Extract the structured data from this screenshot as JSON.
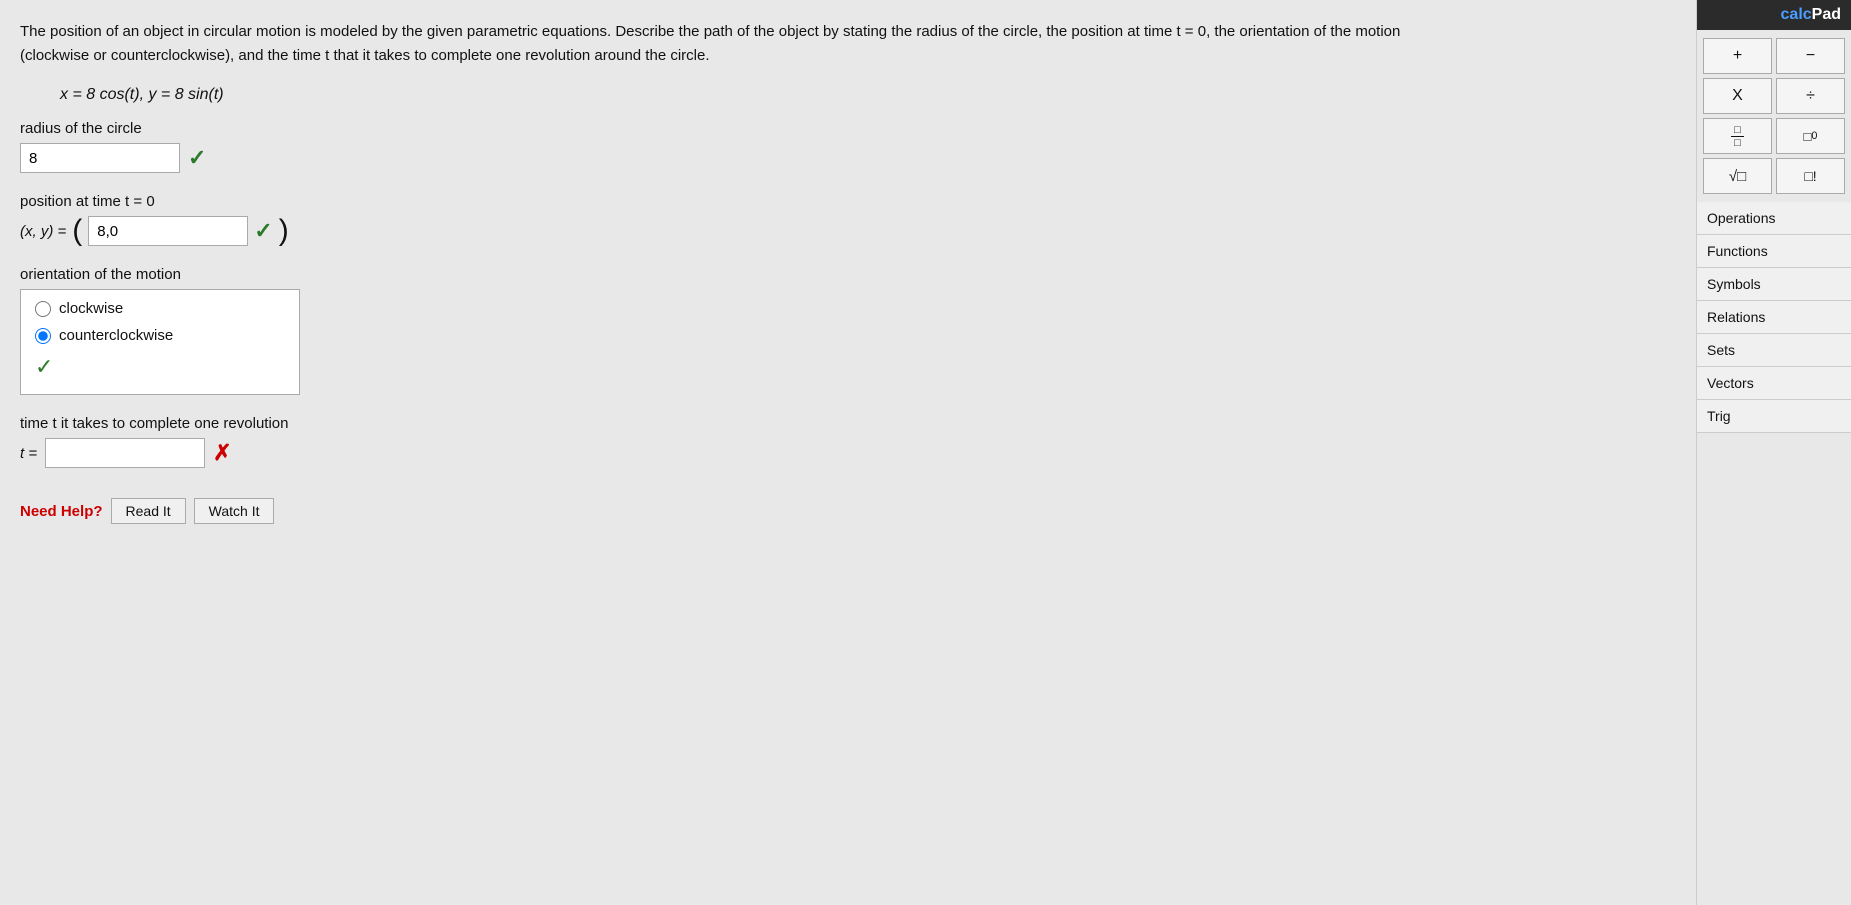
{
  "question": {
    "text": "The position of an object in circular motion is modeled by the given parametric equations. Describe the path of the object by stating the radius of the circle, the position at time t = 0, the orientation of the motion (clockwise or counterclockwise), and the time t that it takes to complete one revolution around the circle.",
    "equation": "x = 8 cos(t),  y = 8 sin(t)"
  },
  "radius": {
    "label": "radius of the circle",
    "value": "8"
  },
  "position": {
    "label": "position at time  t = 0",
    "prefix": "(x, y) =",
    "value": "8,0"
  },
  "orientation": {
    "label": "orientation of the motion",
    "options": [
      "clockwise",
      "counterclockwise"
    ],
    "selected": "counterclockwise"
  },
  "time": {
    "label": "time t it takes to complete one revolution",
    "prefix": "t =",
    "value": ""
  },
  "needHelp": {
    "text": "Need Help?",
    "buttons": [
      "Read It",
      "Watch It"
    ]
  },
  "calcpad": {
    "title_blue": "calc",
    "title_white": "Pad",
    "buttons": [
      {
        "label": "+",
        "id": "plus"
      },
      {
        "label": "−",
        "id": "minus"
      },
      {
        "label": "X",
        "id": "multiply"
      },
      {
        "label": "÷",
        "id": "divide"
      },
      {
        "label": "□/□",
        "id": "fraction"
      },
      {
        "label": "□⁰",
        "id": "power"
      },
      {
        "label": "√□",
        "id": "sqrt"
      },
      {
        "label": "□!",
        "id": "factorial"
      }
    ],
    "menu": [
      "Operations",
      "Functions",
      "Symbols",
      "Relations",
      "Sets",
      "Vectors",
      "Trig"
    ]
  }
}
